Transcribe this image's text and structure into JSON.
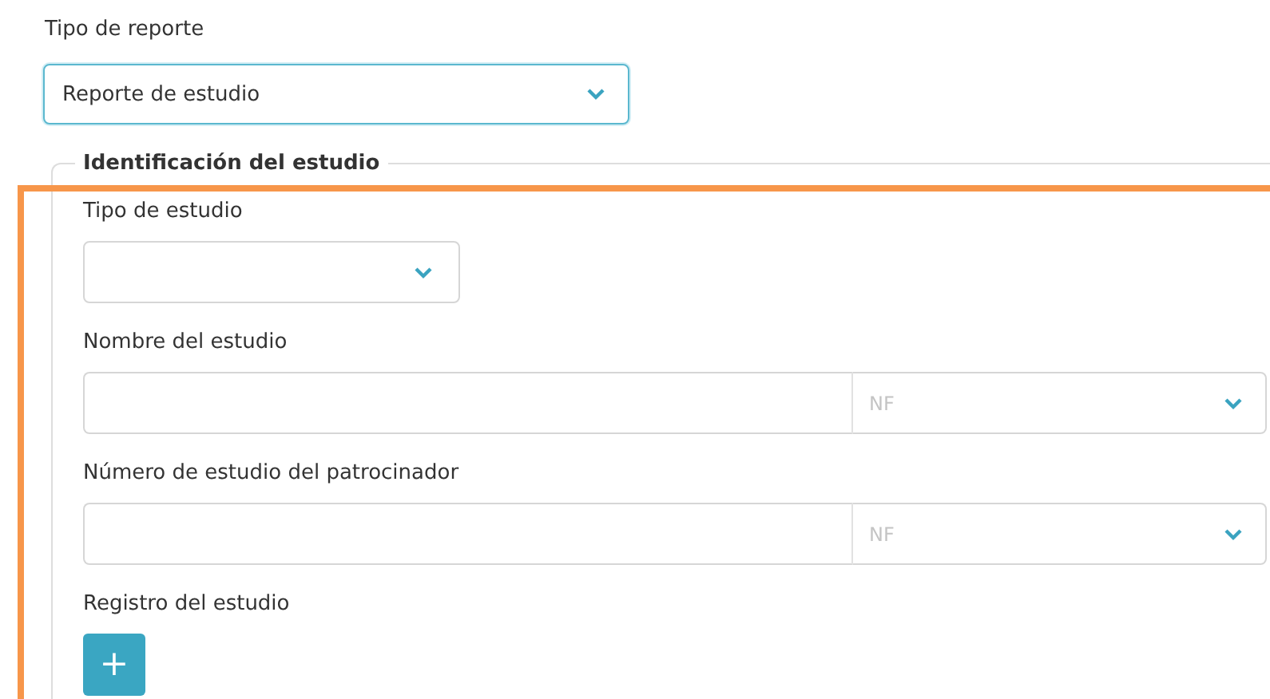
{
  "report_type": {
    "label": "Tipo de reporte",
    "value": "Reporte de estudio",
    "focused": true
  },
  "section": {
    "legend": "Identificación del estudio",
    "highlighted": true,
    "fields": [
      {
        "kind": "select",
        "label": "Tipo de estudio"
      },
      {
        "kind": "input_with_select",
        "label": "Nombre del estudio",
        "unit_placeholder": "NF"
      },
      {
        "kind": "input_with_select",
        "label": "Número de estudio del patrocinador",
        "unit_placeholder": "NF"
      },
      {
        "kind": "add",
        "label": "Registro del estudio",
        "button": "+"
      }
    ]
  }
}
